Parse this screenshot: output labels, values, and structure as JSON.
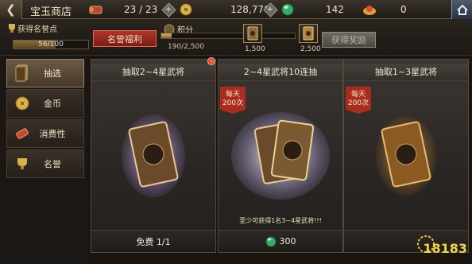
{
  "header": {
    "title": "宝玉商店",
    "stamina": "23 / 23",
    "gold": "128,776",
    "jade": "142",
    "gems": "0"
  },
  "honor": {
    "label": "获得名誉点",
    "progress_text": "56/100",
    "progress_fraction": 0.56,
    "benefit_button": "名誉福利"
  },
  "points": {
    "label": "积分",
    "count": "190/2,500",
    "progress_fraction": 0.076,
    "milestone_1": "1,500",
    "milestone_2": "2,500",
    "claim_button": "获得奖励"
  },
  "tabs": [
    {
      "label": "抽选",
      "icon": "card-draw-icon"
    },
    {
      "label": "金币",
      "icon": "gold-coin-icon"
    },
    {
      "label": "消费性",
      "icon": "scroll-icon"
    },
    {
      "label": "名誉",
      "icon": "trophy-icon"
    }
  ],
  "cards": [
    {
      "title": "抽取2~4星武将",
      "footer": "免费 1/1",
      "ribbon": "",
      "note": ""
    },
    {
      "title": "2~4星武将10连抽",
      "footer": "300",
      "ribbon": "每天\n200次",
      "note": "至少可获得1名3~4星武将!!!"
    },
    {
      "title": "抽取1~3星武将",
      "footer": "",
      "ribbon": "每天\n200次",
      "note": ""
    }
  ],
  "watermark": "18183",
  "colors": {
    "accent_red": "#a82d1f",
    "gold": "#d6b26a",
    "frame": "#54493d"
  }
}
